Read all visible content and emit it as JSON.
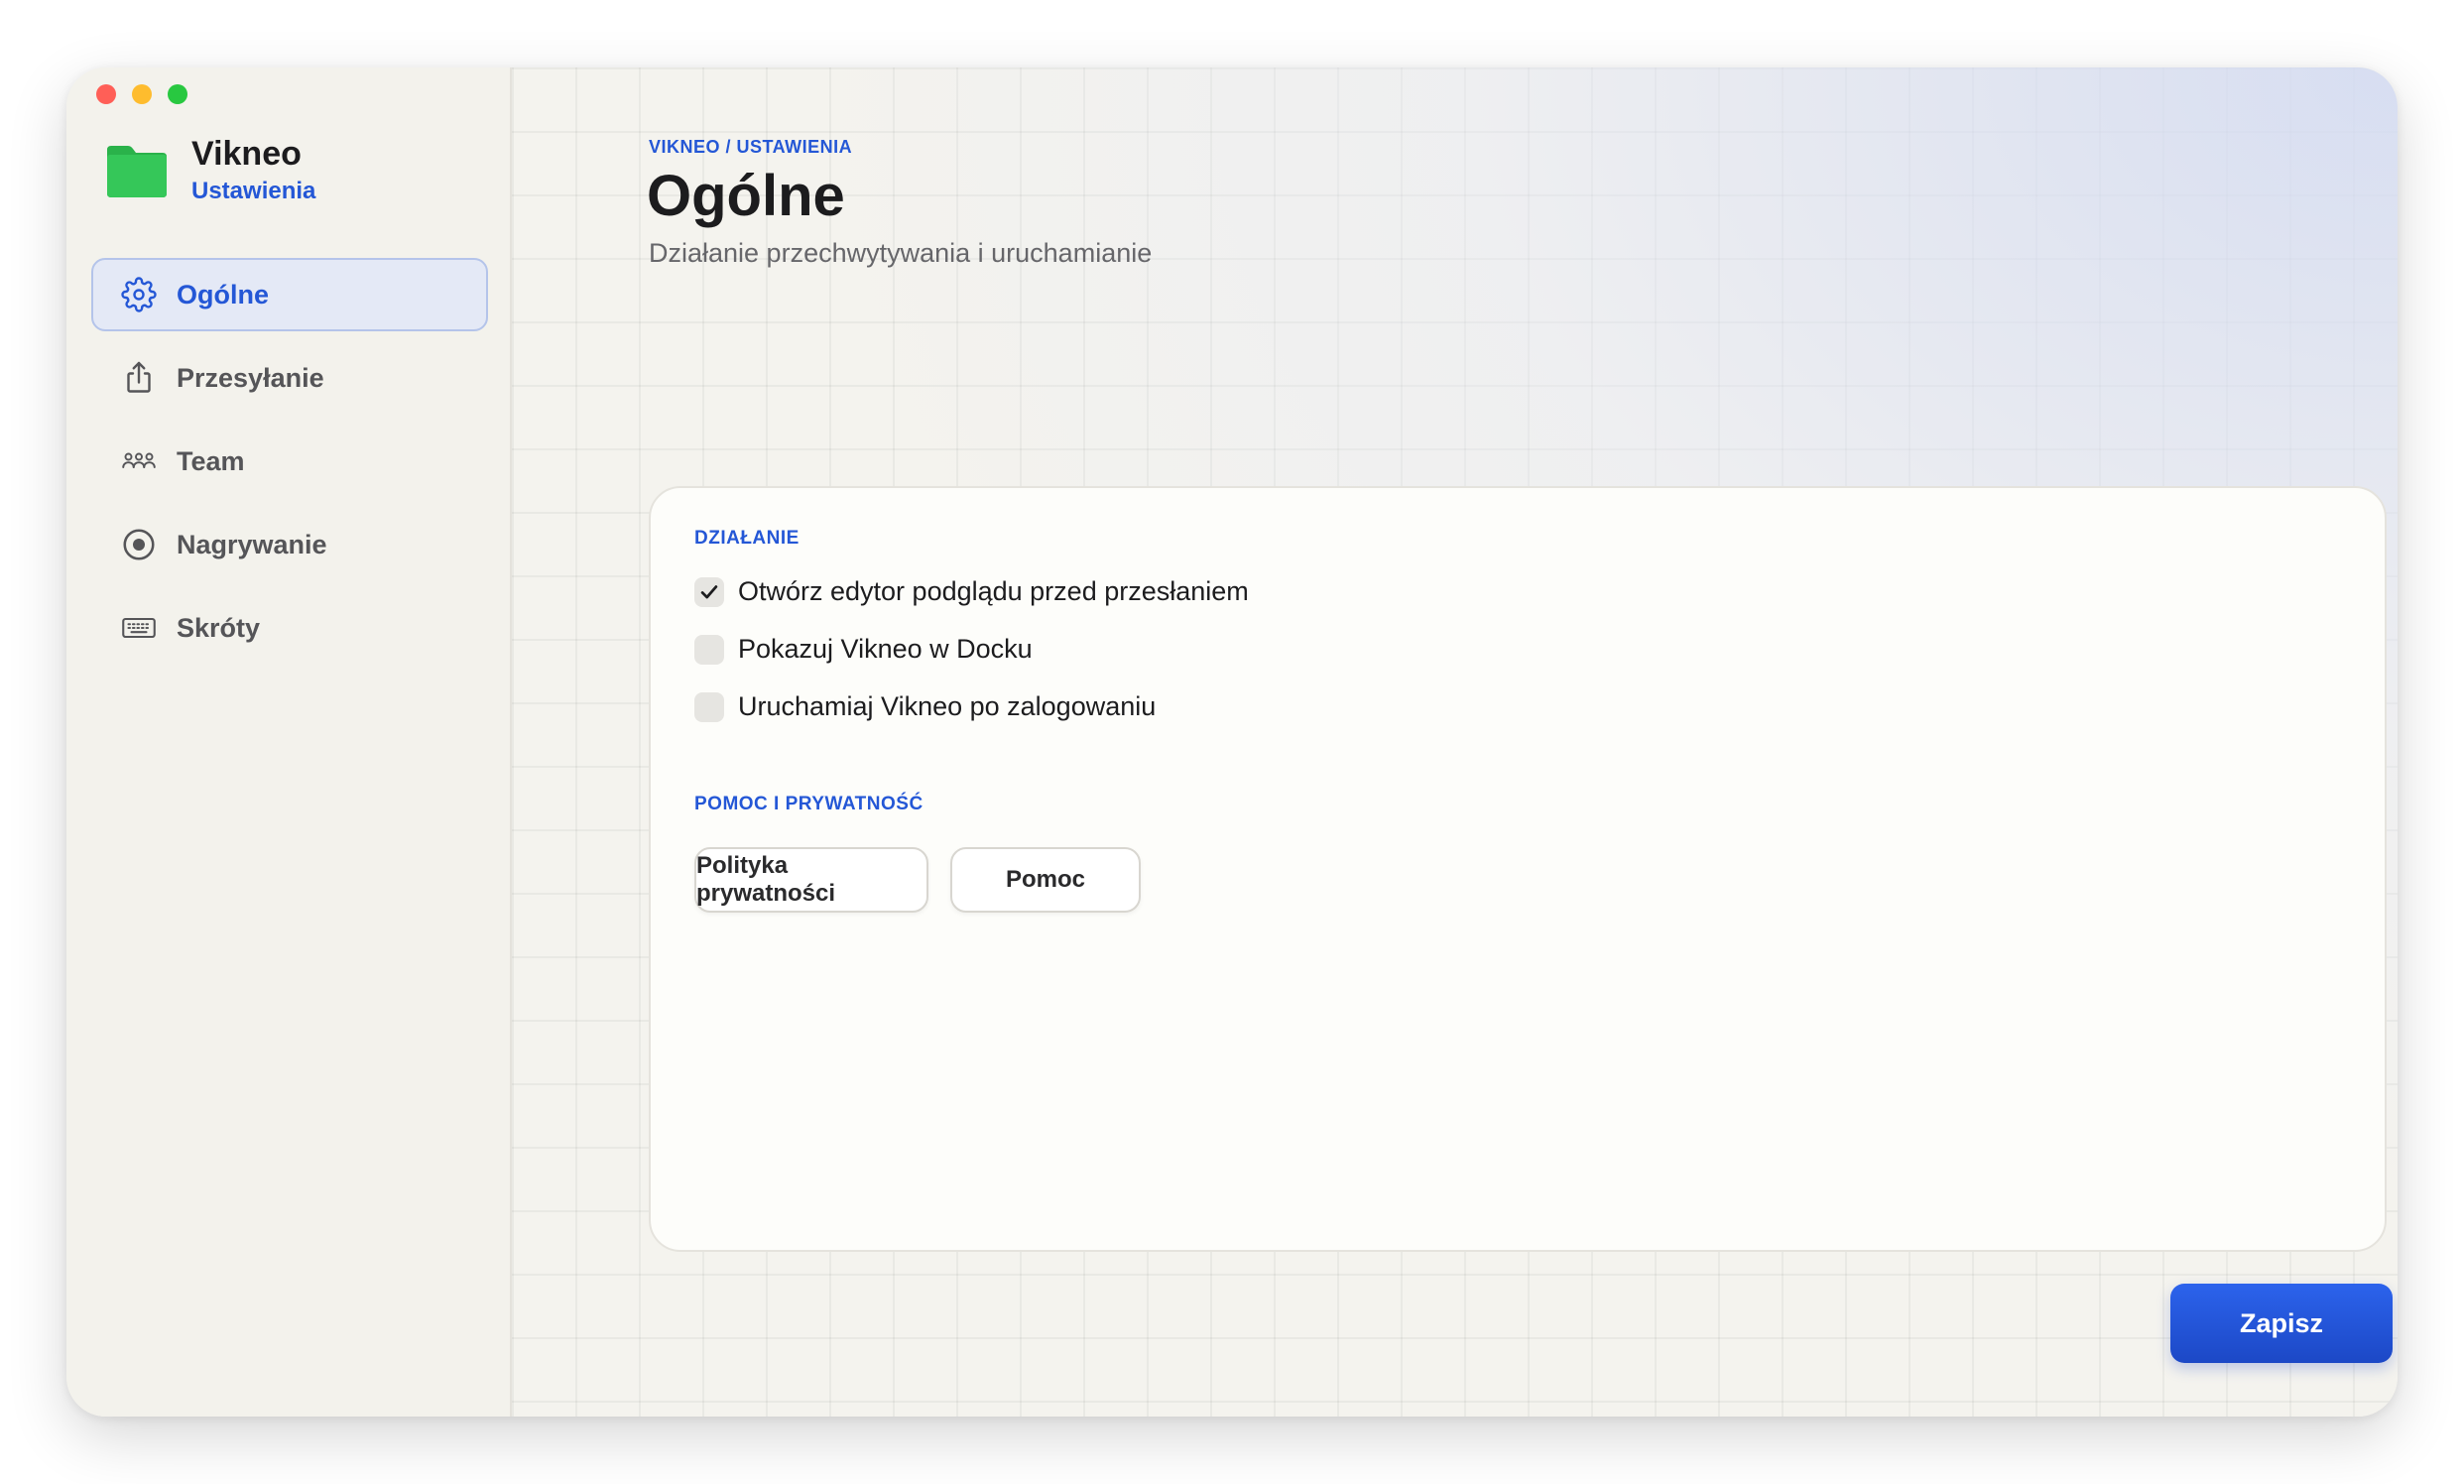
{
  "window": {
    "traffic_lights": [
      "#ff5f57",
      "#febc2e",
      "#28c840"
    ]
  },
  "app": {
    "name": "Vikneo",
    "subtitle": "Ustawienia",
    "icon": "folder-icon",
    "accent": "#2457d6"
  },
  "sidebar": {
    "items": [
      {
        "label": "Ogólne",
        "icon": "gear-icon",
        "active": true
      },
      {
        "label": "Przesyłanie",
        "icon": "share-icon",
        "active": false
      },
      {
        "label": "Team",
        "icon": "people-icon",
        "active": false
      },
      {
        "label": "Nagrywanie",
        "icon": "record-icon",
        "active": false
      },
      {
        "label": "Skróty",
        "icon": "keyboard-icon",
        "active": false
      }
    ]
  },
  "header": {
    "breadcrumb": "VIKNEO / USTAWIENIA",
    "title": "Ogólne",
    "subtitle": "Działanie przechwytywania i uruchamianie"
  },
  "card": {
    "section_action": "DZIAŁANIE",
    "options": [
      {
        "label": "Otwórz edytor podglądu przed przesłaniem",
        "checked": true
      },
      {
        "label": "Pokazuj Vikneo w Docku",
        "checked": false
      },
      {
        "label": "Uruchamiaj Vikneo po zalogowaniu",
        "checked": false
      }
    ],
    "section_help": "POMOC I PRYWATNOŚĆ",
    "privacy_button": "Polityka prywatności",
    "help_button": "Pomoc"
  },
  "footer": {
    "save_label": "Zapisz"
  }
}
